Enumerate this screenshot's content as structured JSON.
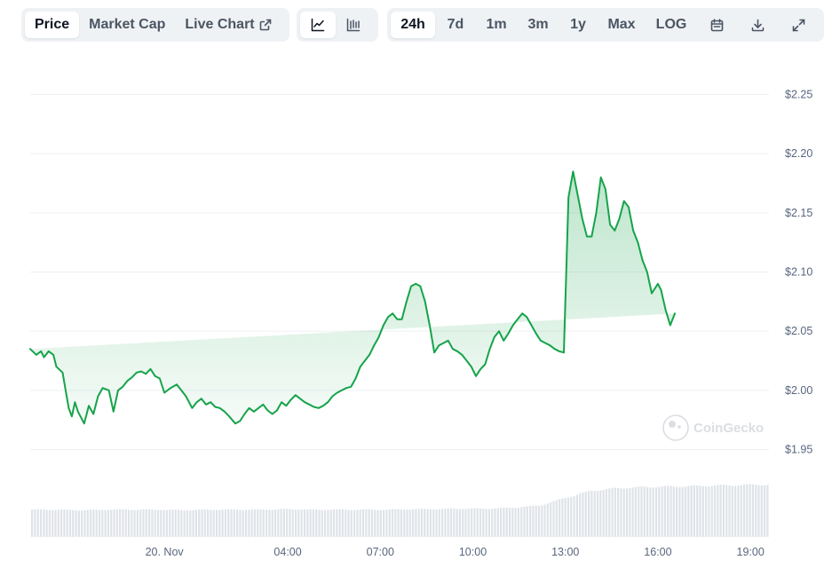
{
  "toolbar": {
    "metric_tabs": [
      {
        "label": "Price",
        "active": true
      },
      {
        "label": "Market Cap",
        "active": false
      },
      {
        "label": "Live Chart",
        "active": false
      }
    ],
    "chart_type_icons": [
      "line-chart-icon",
      "candlestick-chart-icon"
    ],
    "range_tabs": [
      {
        "label": "24h",
        "active": true
      },
      {
        "label": "7d",
        "active": false
      },
      {
        "label": "1m",
        "active": false
      },
      {
        "label": "3m",
        "active": false
      },
      {
        "label": "1y",
        "active": false
      },
      {
        "label": "Max",
        "active": false
      },
      {
        "label": "LOG",
        "active": false
      }
    ],
    "tool_icons": [
      "calendar-icon",
      "download-icon",
      "expand-icon"
    ]
  },
  "watermark": "CoinGecko",
  "colors": {
    "line": "#16a34a",
    "fill_top": "#c9ecd3",
    "grid": "#eef0f3",
    "volume": "#dfe3e8",
    "axis_text": "#58667e"
  },
  "chart_data": {
    "type": "line",
    "y_ticks": [
      "$1.95",
      "$2.00",
      "$2.05",
      "$2.10",
      "$2.15",
      "$2.20",
      "$2.25"
    ],
    "y_tick_values": [
      1.95,
      2.0,
      2.05,
      2.1,
      2.15,
      2.2,
      2.25
    ],
    "ylim": [
      1.95,
      2.25
    ],
    "x_ticks": [
      "20. Nov",
      "04:00",
      "07:00",
      "10:00",
      "13:00",
      "16:00",
      "19:00"
    ],
    "x_tick_hours": [
      0,
      4,
      7,
      10,
      13,
      16,
      19
    ],
    "xlim_hours": [
      -4.35,
      19.6
    ],
    "grid": true,
    "legend": "none",
    "series": [
      {
        "x_hours": [
          -4.35,
          -4.15,
          -4.0,
          -3.9,
          -3.75,
          -3.6,
          -3.5,
          -3.3,
          -3.2,
          -3.1,
          -3.0,
          -2.9,
          -2.8,
          -2.6,
          -2.45,
          -2.3,
          -2.15,
          -2.0,
          -1.8,
          -1.65,
          -1.5,
          -1.35,
          -1.2,
          -1.05,
          -0.9,
          -0.75,
          -0.6,
          -0.45,
          -0.3,
          -0.15,
          0.0,
          0.2,
          0.4,
          0.55,
          0.7,
          0.9,
          1.05,
          1.2,
          1.35,
          1.5,
          1.65,
          1.8,
          1.95,
          2.1,
          2.3,
          2.45,
          2.6,
          2.75,
          2.9,
          3.05,
          3.2,
          3.35,
          3.5,
          3.65,
          3.8,
          3.95,
          4.1,
          4.25,
          4.4,
          4.55,
          4.7,
          4.85,
          5.0,
          5.15,
          5.3,
          5.45,
          5.6,
          5.75,
          5.9,
          6.05,
          6.2,
          6.35,
          6.5,
          6.65,
          6.8,
          6.95,
          7.1,
          7.25,
          7.4,
          7.55,
          7.7,
          7.85,
          8.0,
          8.15,
          8.3,
          8.45,
          8.6,
          8.75,
          8.9,
          9.05,
          9.2,
          9.35,
          9.5,
          9.65,
          9.8,
          9.95,
          10.1,
          10.25,
          10.4,
          10.55,
          10.7,
          10.85,
          11.0,
          11.15,
          11.3,
          11.45,
          11.6,
          11.75,
          11.9,
          12.05,
          12.2,
          12.35,
          12.5,
          12.65,
          12.8,
          12.95,
          13.1,
          13.25,
          13.4,
          13.55,
          13.7,
          13.85,
          14.0,
          14.15,
          14.3,
          14.45,
          14.6,
          14.75,
          14.9,
          15.05,
          15.2,
          15.35,
          15.5,
          15.65,
          15.8,
          16.0,
          16.1,
          16.25,
          16.4,
          16.55,
          16.7,
          16.85,
          17.0,
          17.15,
          17.3,
          17.45,
          17.6,
          17.75,
          17.9,
          18.05,
          18.2,
          18.35,
          18.5,
          18.65,
          18.8,
          18.95,
          19.1,
          19.25,
          19.4,
          19.6
        ],
        "values": [
          2.035,
          2.03,
          2.033,
          2.028,
          2.033,
          2.03,
          2.02,
          2.015,
          2.0,
          1.985,
          1.978,
          1.99,
          1.982,
          1.972,
          1.987,
          1.98,
          1.995,
          2.002,
          2.0,
          1.982,
          2.0,
          2.003,
          2.008,
          2.011,
          2.015,
          2.016,
          2.014,
          2.018,
          2.012,
          2.01,
          1.998,
          2.002,
          2.005,
          2.0,
          1.995,
          1.985,
          1.99,
          1.993,
          1.988,
          1.99,
          1.986,
          1.985,
          1.982,
          1.978,
          1.972,
          1.974,
          1.98,
          1.985,
          1.982,
          1.985,
          1.988,
          1.983,
          1.98,
          1.983,
          1.99,
          1.987,
          1.992,
          1.996,
          1.993,
          1.99,
          1.988,
          1.986,
          1.985,
          1.987,
          1.99,
          1.995,
          1.998,
          2.0,
          2.002,
          2.003,
          2.01,
          2.02,
          2.025,
          2.03,
          2.038,
          2.045,
          2.055,
          2.062,
          2.065,
          2.06,
          2.06,
          2.075,
          2.088,
          2.09,
          2.088,
          2.075,
          2.055,
          2.032,
          2.038,
          2.04,
          2.042,
          2.035,
          2.033,
          2.03,
          2.025,
          2.02,
          2.012,
          2.018,
          2.022,
          2.035,
          2.045,
          2.05,
          2.042,
          2.048,
          2.055,
          2.06,
          2.065,
          2.062,
          2.055,
          2.048,
          2.042,
          2.04,
          2.038,
          2.035,
          2.033,
          2.032,
          2.163,
          2.185,
          2.165,
          2.145,
          2.13,
          2.13,
          2.15,
          2.18,
          2.17,
          2.14,
          2.135,
          2.145,
          2.16,
          2.155,
          2.135,
          2.125,
          2.11,
          2.1,
          2.082,
          2.09,
          2.085,
          2.068,
          2.055,
          2.065
        ],
        "_note": ""
      }
    ],
    "volume": {
      "relative_levels": [
        0.52,
        0.52,
        0.51,
        0.52,
        0.52,
        0.52,
        0.51,
        0.52,
        0.52,
        0.52,
        0.53,
        0.52,
        0.52,
        0.52,
        0.52,
        0.53,
        0.53,
        0.54,
        0.54,
        0.56,
        0.6,
        0.75,
        0.88,
        0.93,
        0.95,
        0.96,
        0.97,
        0.98,
        0.99,
        1.0
      ]
    }
  }
}
